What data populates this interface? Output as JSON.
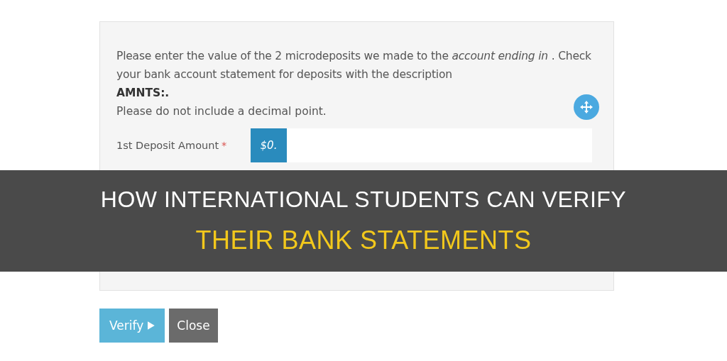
{
  "form": {
    "intro": "Please enter the value of the 2 microdeposits we made to the *account ending in* . Check your bank account statement for deposits with the description",
    "code": "AMNTS:.",
    "note": "Please do not include a decimal point.",
    "fields": [
      {
        "label": "1st Deposit Amount",
        "marker": "*",
        "prefix": "$0."
      }
    ],
    "buttons": [
      {
        "label": "Verify",
        "kind": "primary"
      },
      {
        "label": "Close",
        "kind": "secondary"
      }
    ]
  },
  "banner": {
    "lines": [
      {
        "text": "HOW INTERNATIONAL STUDENTS CAN VERIFY",
        "kind": "plain"
      },
      {
        "text": "THEIR BANK STATEMENTS",
        "kind": "accent"
      }
    ]
  }
}
